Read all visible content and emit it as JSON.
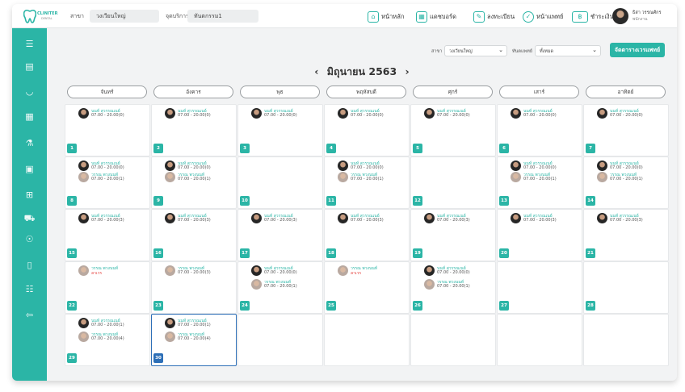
{
  "app": {
    "brand": "CLINITER",
    "brand_sub": "DENTAL"
  },
  "topbar": {
    "branch_label": "สาขา",
    "branch_value": "วงเวียนใหญ่",
    "service_label": "จุดบริการ",
    "service_value": "ทันตกรรม1",
    "nav": [
      {
        "label": "หน้าหลัก",
        "icon": "home-icon"
      },
      {
        "label": "แดชบอร์ด",
        "icon": "dashboard-icon"
      },
      {
        "label": "ลงทะเบียน",
        "icon": "register-icon"
      },
      {
        "label": "หน้าแพทย์",
        "icon": "doctor-icon"
      },
      {
        "label": "ชำระเงิน",
        "icon": "payment-icon"
      }
    ],
    "user_name": "ธิสา วรรณศักร",
    "user_role": "พนักงาน"
  },
  "filters": {
    "branch_label": "สาขา",
    "branch_value": "วงเวียนใหญ่",
    "doctor_label": "ทันตแพทย์",
    "doctor_value": "ทั้งหมด",
    "schedule_button": "จัดตารางเวรแพทย์"
  },
  "calendar": {
    "prev": "‹",
    "next": "›",
    "month_title": "มิถุนายน 2563",
    "days": [
      "จันทร์",
      "อังคาร",
      "พุธ",
      "พฤหัสบดี",
      "ศุกร์",
      "เสาร์",
      "อาทิตย์"
    ],
    "weeks": [
      [
        {
          "day": "1",
          "entries": [
            {
              "name": "นนท์ สุวรรณเนย์",
              "time": "07.00 - 20.00(0)",
              "avatar": "dark"
            }
          ]
        },
        {
          "day": "2",
          "entries": [
            {
              "name": "นนท์ สุวรรณเนย์",
              "time": "07.00 - 20.00(0)",
              "avatar": "dark"
            }
          ]
        },
        {
          "day": "3",
          "entries": [
            {
              "name": "นนท์ สุวรรณเนย์",
              "time": "07.00 - 20.00(0)",
              "avatar": "dark"
            }
          ]
        },
        {
          "day": "4",
          "entries": [
            {
              "name": "นนท์ สุวรรณเนย์",
              "time": "07.00 - 20.00(0)",
              "avatar": "dark"
            }
          ]
        },
        {
          "day": "5",
          "entries": [
            {
              "name": "นนท์ สุวรรณเนย์",
              "time": "07.00 - 20.00(0)",
              "avatar": "dark"
            }
          ]
        },
        {
          "day": "6",
          "entries": [
            {
              "name": "นนท์ สุวรรณเนย์",
              "time": "07.00 - 20.00(0)",
              "avatar": "dark"
            }
          ]
        },
        {
          "day": "7",
          "entries": [
            {
              "name": "นนท์ สุวรรณเนย์",
              "time": "07.00 - 20.00(0)",
              "avatar": "dark"
            }
          ]
        }
      ],
      [
        {
          "day": "8",
          "entries": [
            {
              "name": "นนท์ สุวรรณเนย์",
              "time": "07.00 - 20.00(0)",
              "avatar": "dark"
            },
            {
              "name": "วรรณ พวงนนท์",
              "time": "07.00 - 20.00(1)",
              "avatar": "light"
            }
          ]
        },
        {
          "day": "9",
          "entries": [
            {
              "name": "นนท์ สุวรรณเนย์",
              "time": "07.00 - 20.00(0)",
              "avatar": "dark"
            },
            {
              "name": "วรรณ พวงนนท์",
              "time": "07.00 - 20.00(1)",
              "avatar": "light"
            }
          ]
        },
        {
          "day": "10",
          "entries": []
        },
        {
          "day": "11",
          "entries": [
            {
              "name": "นนท์ สุวรรณเนย์",
              "time": "07.00 - 20.00(0)",
              "avatar": "dark"
            },
            {
              "name": "วรรณ พวงนนท์",
              "time": "07.00 - 20.00(1)",
              "avatar": "light"
            }
          ]
        },
        {
          "day": "12",
          "entries": []
        },
        {
          "day": "13",
          "entries": [
            {
              "name": "นนท์ สุวรรณเนย์",
              "time": "07.00 - 20.00(0)",
              "avatar": "dark"
            },
            {
              "name": "วรรณ พวงนนท์",
              "time": "07.00 - 20.00(1)",
              "avatar": "light"
            }
          ]
        },
        {
          "day": "14",
          "entries": [
            {
              "name": "นนท์ สุวรรณเนย์",
              "time": "07.00 - 20.00(0)",
              "avatar": "dark"
            },
            {
              "name": "วรรณ พวงนนท์",
              "time": "07.00 - 20.00(1)",
              "avatar": "light"
            }
          ]
        }
      ],
      [
        {
          "day": "15",
          "entries": [
            {
              "name": "นนท์ สุวรรณเนย์",
              "time": "07.00 - 20.00(3)",
              "avatar": "dark"
            }
          ]
        },
        {
          "day": "16",
          "entries": [
            {
              "name": "นนท์ สุวรรณเนย์",
              "time": "07.00 - 20.00(3)",
              "avatar": "dark"
            }
          ]
        },
        {
          "day": "17",
          "entries": [
            {
              "name": "นนท์ สุวรรณเนย์",
              "time": "07.00 - 20.00(3)",
              "avatar": "dark"
            }
          ]
        },
        {
          "day": "18",
          "entries": [
            {
              "name": "นนท์ สุวรรณเนย์",
              "time": "07.00 - 20.00(3)",
              "avatar": "dark"
            }
          ]
        },
        {
          "day": "19",
          "entries": [
            {
              "name": "นนท์ สุวรรณเนย์",
              "time": "07.00 - 20.00(3)",
              "avatar": "dark"
            }
          ]
        },
        {
          "day": "20",
          "entries": [
            {
              "name": "นนท์ สุวรรณเนย์",
              "time": "07.00 - 20.00(3)",
              "avatar": "dark"
            }
          ]
        },
        {
          "day": "21",
          "entries": [
            {
              "name": "นนท์ สุวรรณเนย์",
              "time": "07.00 - 20.00(3)",
              "avatar": "dark"
            }
          ]
        }
      ],
      [
        {
          "day": "22",
          "entries": [
            {
              "name": "วรรณ พวงนนท์",
              "time": "ลาเวร",
              "avatar": "light",
              "leave": true
            }
          ]
        },
        {
          "day": "23",
          "entries": [
            {
              "name": "วรรณ พวงนนท์",
              "time": "07.00 - 20.00(3)",
              "avatar": "light"
            }
          ]
        },
        {
          "day": "24",
          "entries": [
            {
              "name": "นนท์ สุวรรณเนย์",
              "time": "07.00 - 20.00(0)",
              "avatar": "dark"
            },
            {
              "name": "วรรณ พวงนนท์",
              "time": "07.00 - 20.00(1)",
              "avatar": "light"
            }
          ]
        },
        {
          "day": "25",
          "entries": [
            {
              "name": "วรรณ พวงนนท์",
              "time": "ลาเวร",
              "avatar": "light",
              "leave": true
            }
          ]
        },
        {
          "day": "26",
          "entries": [
            {
              "name": "นนท์ สุวรรณเนย์",
              "time": "07.00 - 20.00(0)",
              "avatar": "dark"
            },
            {
              "name": "วรรณ พวงนนท์",
              "time": "07.00 - 20.00(1)",
              "avatar": "light"
            }
          ]
        },
        {
          "day": "27",
          "entries": []
        },
        {
          "day": "28",
          "entries": []
        }
      ],
      [
        {
          "day": "29",
          "entries": [
            {
              "name": "นนท์ สุวรรณเนย์",
              "time": "07.00 - 20.00(1)",
              "avatar": "dark"
            },
            {
              "name": "วรรณ พวงนนท์",
              "time": "07.00 - 20.00(4)",
              "avatar": "light"
            }
          ]
        },
        {
          "day": "30",
          "selected": true,
          "entries": [
            {
              "name": "นนท์ สุวรรณเนย์",
              "time": "07.00 - 20.00(1)",
              "avatar": "dark"
            },
            {
              "name": "วรรณ พวงนนท์",
              "time": "07.00 - 20.00(4)",
              "avatar": "light"
            }
          ]
        },
        {
          "day": "",
          "entries": []
        },
        {
          "day": "",
          "entries": []
        },
        {
          "day": "",
          "entries": []
        },
        {
          "day": "",
          "entries": []
        },
        {
          "day": "",
          "entries": []
        }
      ]
    ]
  },
  "sidebar": [
    "menu-icon",
    "clipboard-icon",
    "tooth-icon",
    "calendar-icon",
    "lab-flask-icon",
    "device-icon",
    "grid-icon",
    "cart-icon",
    "hand-money-icon",
    "document-icon",
    "sliders-icon",
    "logout-icon"
  ],
  "colors": {
    "accent": "#2bb5a6",
    "selected": "#2d6fb7",
    "leave": "#e53935"
  }
}
